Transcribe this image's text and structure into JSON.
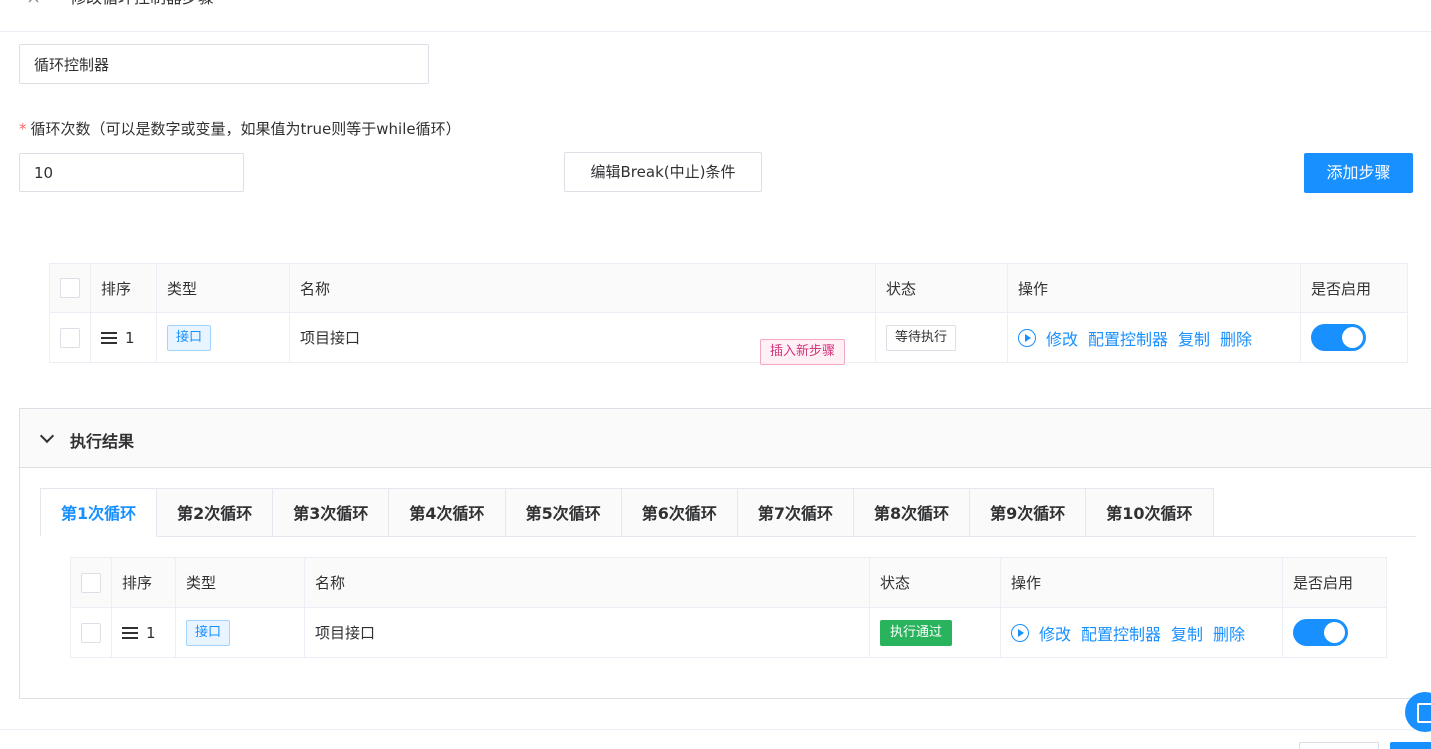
{
  "header": {
    "title": "修改循环控制器步骤",
    "close_icon": "×"
  },
  "form": {
    "name_value": "循环控制器",
    "loop_label": "循环次数（可以是数字或变量，如果值为true则等于while循环）",
    "required_mark": "*",
    "loop_value": "10",
    "break_button": "编辑Break(中止)条件",
    "add_step_button": "添加步骤"
  },
  "steps_table": {
    "columns": [
      "排序",
      "类型",
      "名称",
      "状态",
      "操作",
      "是否启用"
    ],
    "rows": [
      {
        "order": "1",
        "type": "接口",
        "name": "项目接口",
        "status": "等待执行",
        "actions": [
          "修改",
          "配置控制器",
          "复制",
          "删除"
        ],
        "enabled": true
      }
    ],
    "insert_tag": "插入新步骤"
  },
  "result": {
    "title": "执行结果",
    "tabs": [
      "第1次循环",
      "第2次循环",
      "第3次循环",
      "第4次循环",
      "第5次循环",
      "第6次循环",
      "第7次循环",
      "第8次循环",
      "第9次循环",
      "第10次循环"
    ],
    "active_tab": 0,
    "table": {
      "columns": [
        "排序",
        "类型",
        "名称",
        "状态",
        "操作",
        "是否启用"
      ],
      "rows": [
        {
          "order": "1",
          "type": "接口",
          "name": "项目接口",
          "status": "执行通过",
          "actions": [
            "修改",
            "配置控制器",
            "复制",
            "删除"
          ],
          "enabled": true
        }
      ]
    }
  },
  "colors": {
    "primary": "#1890ff",
    "success": "#29b35d",
    "danger": "#f56c6c",
    "pink": "#d6337b"
  }
}
